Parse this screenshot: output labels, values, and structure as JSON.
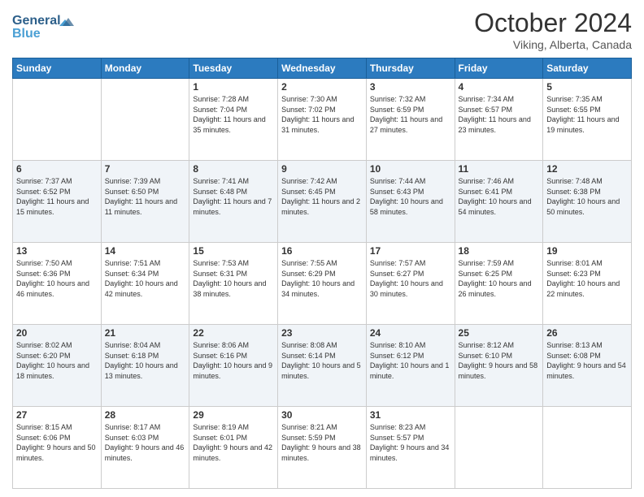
{
  "header": {
    "logo_line1": "General",
    "logo_line2": "Blue",
    "month": "October 2024",
    "location": "Viking, Alberta, Canada"
  },
  "weekdays": [
    "Sunday",
    "Monday",
    "Tuesday",
    "Wednesday",
    "Thursday",
    "Friday",
    "Saturday"
  ],
  "weeks": [
    [
      {
        "day": "",
        "sunrise": "",
        "sunset": "",
        "daylight": ""
      },
      {
        "day": "",
        "sunrise": "",
        "sunset": "",
        "daylight": ""
      },
      {
        "day": "1",
        "sunrise": "Sunrise: 7:28 AM",
        "sunset": "Sunset: 7:04 PM",
        "daylight": "Daylight: 11 hours and 35 minutes."
      },
      {
        "day": "2",
        "sunrise": "Sunrise: 7:30 AM",
        "sunset": "Sunset: 7:02 PM",
        "daylight": "Daylight: 11 hours and 31 minutes."
      },
      {
        "day": "3",
        "sunrise": "Sunrise: 7:32 AM",
        "sunset": "Sunset: 6:59 PM",
        "daylight": "Daylight: 11 hours and 27 minutes."
      },
      {
        "day": "4",
        "sunrise": "Sunrise: 7:34 AM",
        "sunset": "Sunset: 6:57 PM",
        "daylight": "Daylight: 11 hours and 23 minutes."
      },
      {
        "day": "5",
        "sunrise": "Sunrise: 7:35 AM",
        "sunset": "Sunset: 6:55 PM",
        "daylight": "Daylight: 11 hours and 19 minutes."
      }
    ],
    [
      {
        "day": "6",
        "sunrise": "Sunrise: 7:37 AM",
        "sunset": "Sunset: 6:52 PM",
        "daylight": "Daylight: 11 hours and 15 minutes."
      },
      {
        "day": "7",
        "sunrise": "Sunrise: 7:39 AM",
        "sunset": "Sunset: 6:50 PM",
        "daylight": "Daylight: 11 hours and 11 minutes."
      },
      {
        "day": "8",
        "sunrise": "Sunrise: 7:41 AM",
        "sunset": "Sunset: 6:48 PM",
        "daylight": "Daylight: 11 hours and 7 minutes."
      },
      {
        "day": "9",
        "sunrise": "Sunrise: 7:42 AM",
        "sunset": "Sunset: 6:45 PM",
        "daylight": "Daylight: 11 hours and 2 minutes."
      },
      {
        "day": "10",
        "sunrise": "Sunrise: 7:44 AM",
        "sunset": "Sunset: 6:43 PM",
        "daylight": "Daylight: 10 hours and 58 minutes."
      },
      {
        "day": "11",
        "sunrise": "Sunrise: 7:46 AM",
        "sunset": "Sunset: 6:41 PM",
        "daylight": "Daylight: 10 hours and 54 minutes."
      },
      {
        "day": "12",
        "sunrise": "Sunrise: 7:48 AM",
        "sunset": "Sunset: 6:38 PM",
        "daylight": "Daylight: 10 hours and 50 minutes."
      }
    ],
    [
      {
        "day": "13",
        "sunrise": "Sunrise: 7:50 AM",
        "sunset": "Sunset: 6:36 PM",
        "daylight": "Daylight: 10 hours and 46 minutes."
      },
      {
        "day": "14",
        "sunrise": "Sunrise: 7:51 AM",
        "sunset": "Sunset: 6:34 PM",
        "daylight": "Daylight: 10 hours and 42 minutes."
      },
      {
        "day": "15",
        "sunrise": "Sunrise: 7:53 AM",
        "sunset": "Sunset: 6:31 PM",
        "daylight": "Daylight: 10 hours and 38 minutes."
      },
      {
        "day": "16",
        "sunrise": "Sunrise: 7:55 AM",
        "sunset": "Sunset: 6:29 PM",
        "daylight": "Daylight: 10 hours and 34 minutes."
      },
      {
        "day": "17",
        "sunrise": "Sunrise: 7:57 AM",
        "sunset": "Sunset: 6:27 PM",
        "daylight": "Daylight: 10 hours and 30 minutes."
      },
      {
        "day": "18",
        "sunrise": "Sunrise: 7:59 AM",
        "sunset": "Sunset: 6:25 PM",
        "daylight": "Daylight: 10 hours and 26 minutes."
      },
      {
        "day": "19",
        "sunrise": "Sunrise: 8:01 AM",
        "sunset": "Sunset: 6:23 PM",
        "daylight": "Daylight: 10 hours and 22 minutes."
      }
    ],
    [
      {
        "day": "20",
        "sunrise": "Sunrise: 8:02 AM",
        "sunset": "Sunset: 6:20 PM",
        "daylight": "Daylight: 10 hours and 18 minutes."
      },
      {
        "day": "21",
        "sunrise": "Sunrise: 8:04 AM",
        "sunset": "Sunset: 6:18 PM",
        "daylight": "Daylight: 10 hours and 13 minutes."
      },
      {
        "day": "22",
        "sunrise": "Sunrise: 8:06 AM",
        "sunset": "Sunset: 6:16 PM",
        "daylight": "Daylight: 10 hours and 9 minutes."
      },
      {
        "day": "23",
        "sunrise": "Sunrise: 8:08 AM",
        "sunset": "Sunset: 6:14 PM",
        "daylight": "Daylight: 10 hours and 5 minutes."
      },
      {
        "day": "24",
        "sunrise": "Sunrise: 8:10 AM",
        "sunset": "Sunset: 6:12 PM",
        "daylight": "Daylight: 10 hours and 1 minute."
      },
      {
        "day": "25",
        "sunrise": "Sunrise: 8:12 AM",
        "sunset": "Sunset: 6:10 PM",
        "daylight": "Daylight: 9 hours and 58 minutes."
      },
      {
        "day": "26",
        "sunrise": "Sunrise: 8:13 AM",
        "sunset": "Sunset: 6:08 PM",
        "daylight": "Daylight: 9 hours and 54 minutes."
      }
    ],
    [
      {
        "day": "27",
        "sunrise": "Sunrise: 8:15 AM",
        "sunset": "Sunset: 6:06 PM",
        "daylight": "Daylight: 9 hours and 50 minutes."
      },
      {
        "day": "28",
        "sunrise": "Sunrise: 8:17 AM",
        "sunset": "Sunset: 6:03 PM",
        "daylight": "Daylight: 9 hours and 46 minutes."
      },
      {
        "day": "29",
        "sunrise": "Sunrise: 8:19 AM",
        "sunset": "Sunset: 6:01 PM",
        "daylight": "Daylight: 9 hours and 42 minutes."
      },
      {
        "day": "30",
        "sunrise": "Sunrise: 8:21 AM",
        "sunset": "Sunset: 5:59 PM",
        "daylight": "Daylight: 9 hours and 38 minutes."
      },
      {
        "day": "31",
        "sunrise": "Sunrise: 8:23 AM",
        "sunset": "Sunset: 5:57 PM",
        "daylight": "Daylight: 9 hours and 34 minutes."
      },
      {
        "day": "",
        "sunrise": "",
        "sunset": "",
        "daylight": ""
      },
      {
        "day": "",
        "sunrise": "",
        "sunset": "",
        "daylight": ""
      }
    ]
  ]
}
